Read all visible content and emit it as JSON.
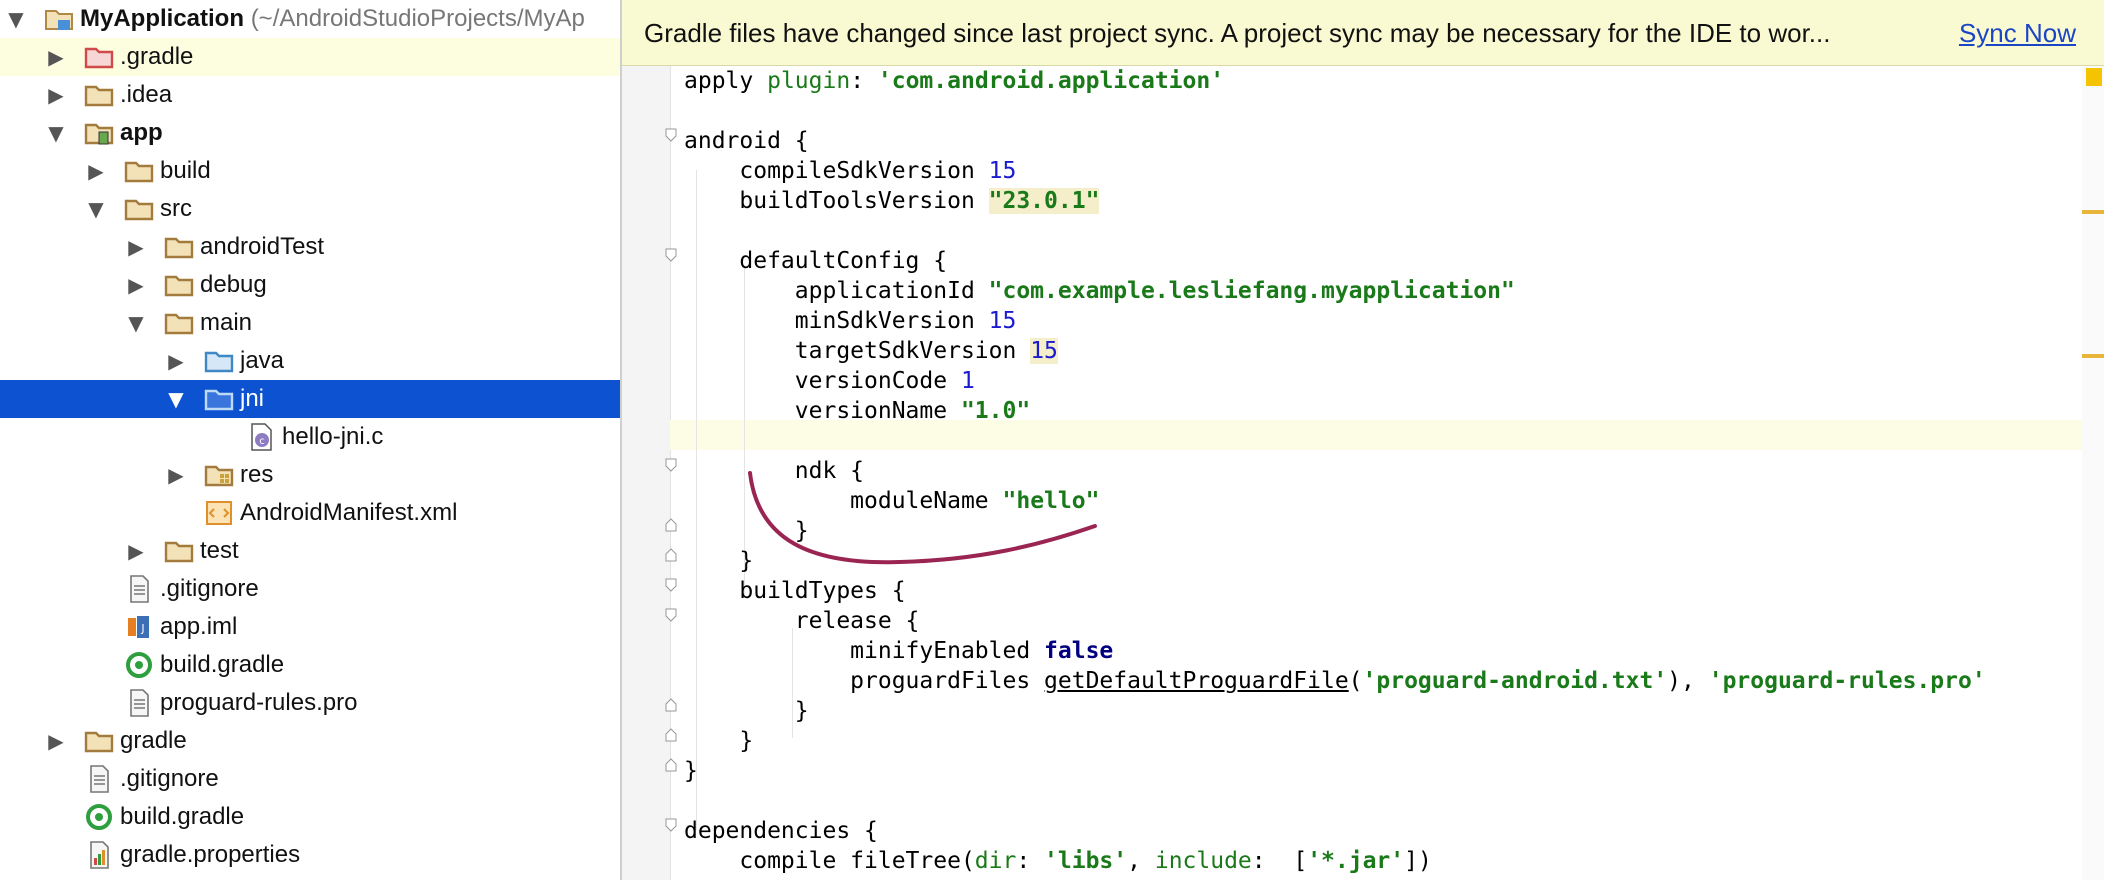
{
  "project_tree": {
    "root": {
      "name": "MyApplication",
      "path": "(~/AndroidStudioProjects/MyAp"
    },
    "items": [
      {
        "label": ".gradle",
        "icon": "gradle-folder-icon"
      },
      {
        "label": ".idea",
        "icon": "folder-icon"
      },
      {
        "label": "app",
        "icon": "module-folder-icon"
      },
      {
        "label": "build",
        "icon": "folder-icon"
      },
      {
        "label": "src",
        "icon": "folder-icon"
      },
      {
        "label": "androidTest",
        "icon": "folder-icon"
      },
      {
        "label": "debug",
        "icon": "folder-icon"
      },
      {
        "label": "main",
        "icon": "folder-icon"
      },
      {
        "label": "java",
        "icon": "source-folder-icon"
      },
      {
        "label": "jni",
        "icon": "source-folder-icon"
      },
      {
        "label": "hello-jni.c",
        "icon": "c-file-icon"
      },
      {
        "label": "res",
        "icon": "resource-folder-icon"
      },
      {
        "label": "AndroidManifest.xml",
        "icon": "manifest-icon"
      },
      {
        "label": "test",
        "icon": "folder-icon"
      },
      {
        "label": ".gitignore",
        "icon": "text-file-icon"
      },
      {
        "label": "app.iml",
        "icon": "iml-file-icon"
      },
      {
        "label": "build.gradle",
        "icon": "gradle-file-icon"
      },
      {
        "label": "proguard-rules.pro",
        "icon": "text-file-icon"
      },
      {
        "label": "gradle",
        "icon": "folder-icon"
      },
      {
        "label": ".gitignore",
        "icon": "text-file-icon"
      },
      {
        "label": "build.gradle",
        "icon": "gradle-file-icon"
      },
      {
        "label": "gradle.properties",
        "icon": "properties-file-icon"
      }
    ]
  },
  "banner": {
    "message": "Gradle files have changed since last project sync. A project sync may be necessary for the IDE to wor...",
    "action": "Sync Now"
  },
  "editor": {
    "t": {
      "apply": "apply ",
      "plugin": "plugin",
      "colon_sp": ": ",
      "plugin_val": "'com.android.application'",
      "android": "android {",
      "compileSdk": "    compileSdkVersion ",
      "compileSdk_val": "15",
      "buildTools": "    buildToolsVersion ",
      "buildTools_val": "\"23.0.1\"",
      "defaultConfig": "    defaultConfig {",
      "appId": "        applicationId ",
      "appId_val": "\"com.example.lesliefang.myapplication\"",
      "minSdk": "        minSdkVersion ",
      "minSdk_val": "15",
      "targetSdk": "        targetSdkVersion ",
      "targetSdk_val": "15",
      "versionCode": "        versionCode ",
      "versionCode_val": "1",
      "versionName": "        versionName ",
      "versionName_val": "\"1.0\"",
      "ndk": "        ndk {",
      "moduleName": "            moduleName ",
      "moduleName_val": "\"hello\"",
      "close8": "        }",
      "close4": "    }",
      "buildTypes": "    buildTypes {",
      "release": "        release {",
      "minify": "            minifyEnabled ",
      "minify_val": "false",
      "proguard": "            proguardFiles ",
      "getDefault": "getDefaultProguardFile",
      "lparen": "(",
      "proguard_txt": "'proguard-android.txt'",
      "rparen_comma": "), ",
      "proguard_rules": "'proguard-rules.pro'",
      "close0": "}",
      "dependencies": "dependencies {",
      "compile": "    compile fileTree(",
      "dir": "dir",
      "libs": "'libs'",
      "comma_sp": ", ",
      "include": "include",
      "bracket_open": " [",
      "jar": "'*.jar'",
      "close_tail": "])"
    }
  },
  "colors": {
    "selection": "#0d52d0",
    "banner_bg": "#fafad2",
    "link": "#1a45c4",
    "string": "#1a7a1a",
    "number": "#1a1ad0",
    "keyword": "#000080",
    "annotation_stroke": "#9b2552"
  }
}
